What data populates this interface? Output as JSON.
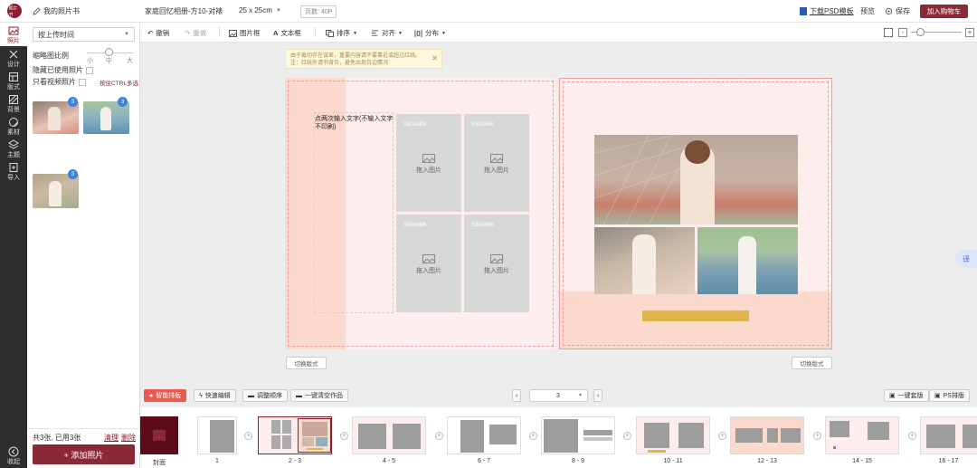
{
  "header": {
    "logo_text": "照片书",
    "back_label": "我的照片书",
    "product_title": "家庭回忆相册-方10-对裱",
    "size_label": "25 x 25cm",
    "page_count": "页数: 40P",
    "download_psd": "下载PSD模板",
    "preview": "预览",
    "save": "保存",
    "add_cart": "加入购物车"
  },
  "rail": {
    "items": [
      {
        "label": "照片",
        "icon": "photo-icon"
      },
      {
        "label": "设计",
        "icon": "design-icon"
      },
      {
        "label": "版式",
        "icon": "layout-icon"
      },
      {
        "label": "背景",
        "icon": "background-icon"
      },
      {
        "label": "素材",
        "icon": "sticker-icon"
      },
      {
        "label": "主题",
        "icon": "theme-icon"
      },
      {
        "label": "导入",
        "icon": "import-icon"
      }
    ],
    "collapse": "收起"
  },
  "panel": {
    "sort_value": "按上传时间",
    "scale_label": "缩略图比例",
    "scale_small": "小",
    "scale_mid": "中",
    "scale_large": "大",
    "hide_used": "隐藏已使用照片",
    "only_video": "只看视频照片",
    "ctrl_hint": "按住CTRL多选",
    "counts": [
      "3",
      "3",
      "3"
    ],
    "summary": "共3张, 已用3张",
    "clear": "清理",
    "delete": "删除",
    "add_photo": "+ 添加照片"
  },
  "toolbar": {
    "undo": "撤销",
    "redo": "重做",
    "picture_box": "图片框",
    "text_box": "文本框",
    "order": "排序",
    "align": "对齐",
    "distribute": "分布"
  },
  "canvas": {
    "tip": "由于裁切存在误差，重要内容请不要靠近或超过红线。注：红线外请书背白，避免出现白边情况",
    "text_placeholder": "点两次输入文字(不输入文字不印刷)",
    "slot_dim": "590x886",
    "slot_label": "拖入图片",
    "switch_layout_left": "切换版式",
    "switch_layout_right": "切换版式",
    "side_btn": "译"
  },
  "bottom": {
    "smart": "智能排版",
    "quick_edit": "快速编辑",
    "reorder": "调整顺序",
    "clear_work": "一键清空作品",
    "page_value": "3",
    "one_key": "一键套版",
    "ps_edit": "PS排版"
  },
  "filmstrip": {
    "labels": [
      "封面",
      "1",
      "2 - 3",
      "4 - 5",
      "6 - 7",
      "8 - 9",
      "10 - 11",
      "12 - 13",
      "14 - 15",
      "16 - 17"
    ]
  },
  "colors": {
    "brand": "#8b1e2f",
    "page_pink": "#fde9e6",
    "page_peach": "#fbd9cc",
    "red_line": "#e8a0a0",
    "title_bar": "#e0b64a",
    "badge": "#3d82e0"
  }
}
